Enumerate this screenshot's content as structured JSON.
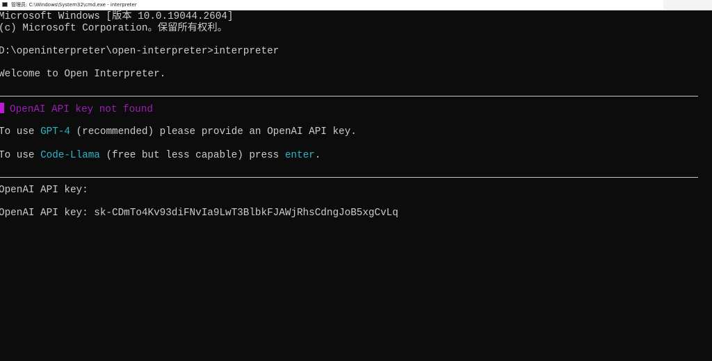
{
  "window": {
    "title": "管理员: C:\\Windows\\System32\\cmd.exe - interpreter"
  },
  "console": {
    "header_line1": "Microsoft Windows [版本 10.0.19044.2604]",
    "header_line2": "(c) Microsoft Corporation。保留所有权利。",
    "prompt_line": "D:\\openinterpreter\\open-interpreter>interpreter",
    "welcome": "Welcome to Open Interpreter.",
    "warning": "OpenAI API key not found",
    "gpt4_prefix": "To use ",
    "gpt4_model": "GPT-4",
    "gpt4_suffix": " (recommended) please provide an OpenAI API key.",
    "llama_prefix": "To use ",
    "llama_model": "Code-Llama",
    "llama_middle": " (free but less capable) press ",
    "llama_key": "enter",
    "llama_suffix": ".",
    "api_prompt_empty": "OpenAI API key:",
    "api_prompt_filled": "OpenAI API key: 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"
  },
  "colors": {
    "background": "#0c0c0c",
    "text": "#cccccc",
    "warning": "#9b1fb5",
    "highlight": "#29b6c8"
  }
}
